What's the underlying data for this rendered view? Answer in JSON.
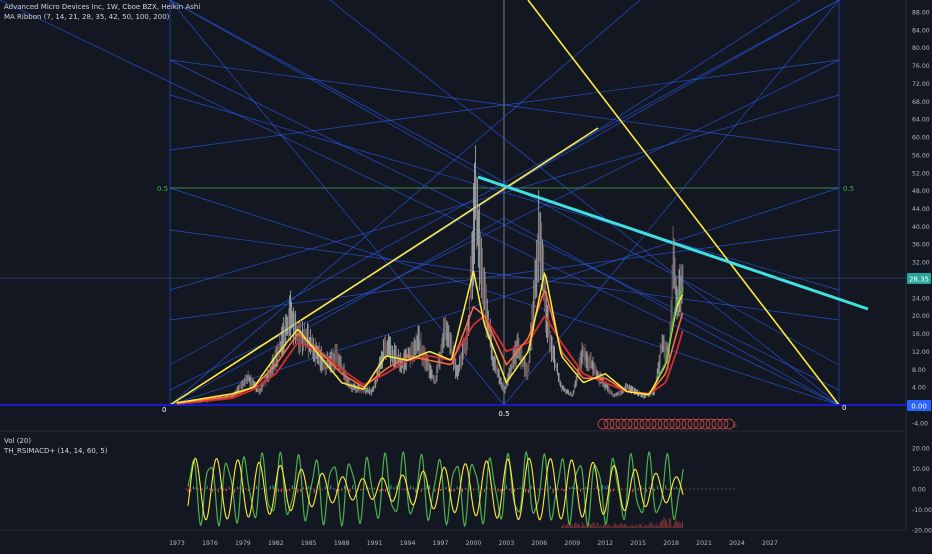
{
  "header": {
    "symbol_line": "Advanced Micro Devices Inc, 1W, Cboe BZX, Heikin Ashi",
    "indicator_line": "MA Ribbon (7, 14, 21, 28, 35, 42, 50, 100, 200)"
  },
  "lower_pane": {
    "volume_label": "Vol (20)",
    "indicator_label": "TH_RSIMACD+ (14, 14, 60, 5)"
  },
  "colors": {
    "background": "#131722",
    "grid_blue": "#2962ff",
    "fan_yellow": "#ffeb3b",
    "trend_cyan": "#40e0e0",
    "level_green": "#4caf50",
    "zero_line": "#1a1acc",
    "price_tag": "#26a69a",
    "ma_red": "#d32f2f",
    "ma_yellow": "#ffeb3b",
    "ma_green": "#4caf50"
  },
  "chart_data": [
    {
      "type": "line",
      "pane": "price",
      "y_ticks": [
        "88.00",
        "84.00",
        "80.00",
        "76.00",
        "72.00",
        "68.00",
        "64.00",
        "60.00",
        "56.00",
        "52.00",
        "48.00",
        "44.00",
        "40.00",
        "36.00",
        "32.00",
        "28.00",
        "24.00",
        "20.00",
        "16.00",
        "12.00",
        "8.00",
        "4.00",
        "0.00",
        "-4.00"
      ],
      "x_ticks": [
        "1973",
        "1976",
        "1979",
        "1982",
        "1985",
        "1988",
        "1991",
        "1994",
        "1997",
        "2000",
        "2003",
        "2006",
        "2009",
        "2012",
        "2015",
        "2018",
        "2021",
        "2024",
        "2027"
      ],
      "ylim": [
        -6,
        92
      ],
      "xlim": [
        1970.8,
        2031.5
      ],
      "last_price_label": "28.35",
      "zero_tag": "0.00",
      "fib_labels": {
        "left_bottom": "0",
        "mid_bottom": "0.5",
        "right_bottom": "0",
        "left_mid": "0.5",
        "right_mid": "0.5"
      },
      "events_marker_label": "E",
      "series": [
        {
          "kind": "price",
          "x": [
            1973,
            1975,
            1978,
            1979.5,
            1980.5,
            1982,
            1983.4,
            1984,
            1985,
            1986.5,
            1987.5,
            1988.8,
            1990.8,
            1992,
            1993.5,
            1995,
            1996.5,
            1997.5,
            1998.5,
            1999.5,
            2000.2,
            2000.8,
            2001.8,
            2002.8,
            2004,
            2005,
            2006,
            2006.6,
            2007.2,
            2008,
            2009,
            2010,
            2011.5,
            2012.8,
            2014,
            2015.5,
            2016.5,
            2017.2,
            2017.8,
            2018.2,
            2018.6,
            2019.1
          ],
          "values": [
            0.4,
            0.7,
            2,
            6,
            3,
            10,
            20,
            16,
            14,
            9,
            11,
            4,
            3,
            13,
            9,
            14,
            5,
            18,
            7,
            16,
            47,
            28,
            10,
            3,
            13,
            7,
            40,
            22,
            12,
            4,
            2,
            12,
            6,
            2,
            4,
            2,
            3,
            14,
            10,
            32,
            22,
            28.35
          ]
        },
        {
          "kind": "ma",
          "period": "long",
          "x": [
            1973,
            1978,
            1980,
            1982,
            1984,
            1986,
            1988,
            1990,
            1992,
            1994,
            1996,
            1998,
            2000,
            2001,
            2003,
            2005,
            2006.5,
            2008,
            2010,
            2012,
            2014,
            2016,
            2017.5,
            2018.5,
            2019.1
          ],
          "values": [
            0.3,
            1.5,
            3.5,
            7,
            14,
            12,
            8,
            4.5,
            7,
            10,
            11,
            10,
            18,
            20,
            12,
            14,
            20,
            14,
            7,
            5,
            3,
            2.5,
            5,
            12,
            17
          ]
        },
        {
          "kind": "ma",
          "period": "mid",
          "x": [
            1973,
            1978,
            1980,
            1982,
            1984,
            1986,
            1988,
            1990,
            1992,
            1994,
            1996,
            1998,
            2000,
            2001,
            2003,
            2005,
            2006.5,
            2008,
            2010,
            2012,
            2014,
            2016,
            2017.5,
            2018.5,
            2019.1
          ],
          "values": [
            0.4,
            2,
            4,
            9,
            16,
            12,
            7,
            4,
            8,
            11,
            10,
            9,
            22,
            20,
            9,
            15,
            26,
            12,
            6,
            6,
            3,
            2.5,
            7,
            16,
            21
          ]
        },
        {
          "kind": "ma",
          "period": "short",
          "x": [
            1973,
            1978,
            1980,
            1982,
            1984,
            1986,
            1988,
            1990,
            1992,
            1994,
            1996,
            1998,
            2000,
            2001,
            2003,
            2005,
            2006.5,
            2008,
            2010,
            2012,
            2014,
            2016,
            2017.5,
            2018.5,
            2019.1
          ],
          "values": [
            0.5,
            2.5,
            4,
            11,
            17,
            11,
            5,
            3.5,
            11,
            10,
            12,
            10,
            30,
            18,
            5,
            12,
            30,
            11,
            5,
            7,
            3,
            2.3,
            9,
            22,
            25
          ]
        }
      ]
    },
    {
      "type": "line",
      "pane": "oscillator",
      "y_ticks": [
        "20.00",
        "10.00",
        "0.00",
        "-10.00",
        "-20.00"
      ],
      "ylim": [
        -24,
        24
      ],
      "oscillator": {
        "x_start": 1974,
        "x_end": 2019.1,
        "fast_cycle_years": 1.6,
        "fast_amplitude": 14,
        "slow_cycle_years": 1.9,
        "slow_amplitude": 10
      }
    }
  ]
}
